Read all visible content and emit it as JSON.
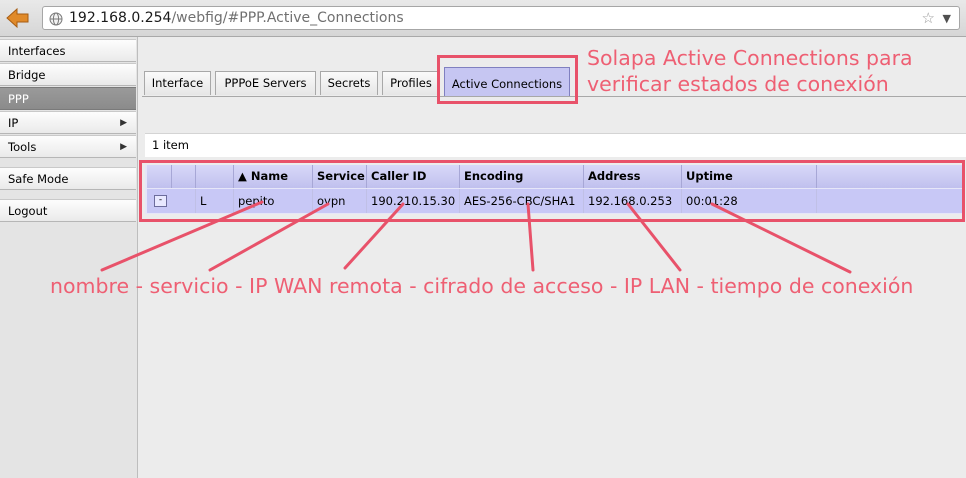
{
  "browser": {
    "url_host": "192.168.0.254",
    "url_path": "/webfig/#PPP.Active_Connections"
  },
  "sidebar": {
    "items": [
      {
        "label": "Interfaces",
        "has_arrow": false
      },
      {
        "label": "Bridge",
        "has_arrow": false
      },
      {
        "label": "PPP",
        "has_arrow": false,
        "active": true
      },
      {
        "label": "IP",
        "has_arrow": true
      },
      {
        "label": "Tools",
        "has_arrow": true
      },
      {
        "label": "Safe Mode",
        "has_arrow": false
      },
      {
        "label": "Logout",
        "has_arrow": false
      }
    ],
    "arrow_glyph": "▶"
  },
  "tabs": [
    {
      "label": "Interface"
    },
    {
      "label": "PPPoE Servers"
    },
    {
      "label": "Secrets"
    },
    {
      "label": "Profiles"
    },
    {
      "label": "Active Connections",
      "active": true
    }
  ],
  "list": {
    "count_text": "1 item",
    "columns": [
      "",
      "",
      "▲ Name",
      "Service",
      "Caller ID",
      "Encoding",
      "Address",
      "Uptime"
    ],
    "rows": [
      {
        "toggle": "-",
        "flag": "L",
        "name": "pepito",
        "service": "ovpn",
        "caller_id": "190.210.15.30",
        "encoding": "AES-256-CBC/SHA1",
        "address": "192.168.0.253",
        "uptime": "00:01:28"
      }
    ]
  },
  "annotations": {
    "tab_note_line1": "Solapa Active Connections para",
    "tab_note_line2": "verificar estados de conexión",
    "fields_note": "nombre - servicio - IP WAN remota - cifrado de acceso - IP LAN - tiempo de conexión",
    "color": "#e8526a"
  }
}
